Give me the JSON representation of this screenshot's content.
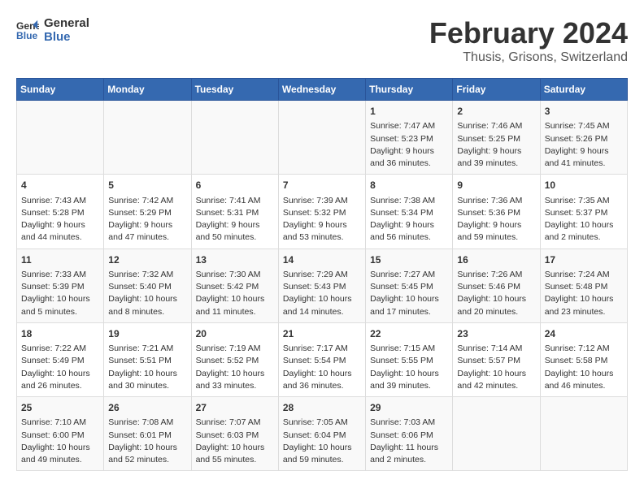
{
  "header": {
    "logo_line1": "General",
    "logo_line2": "Blue",
    "month_year": "February 2024",
    "location": "Thusis, Grisons, Switzerland"
  },
  "days_of_week": [
    "Sunday",
    "Monday",
    "Tuesday",
    "Wednesday",
    "Thursday",
    "Friday",
    "Saturday"
  ],
  "weeks": [
    [
      {
        "day": "",
        "content": ""
      },
      {
        "day": "",
        "content": ""
      },
      {
        "day": "",
        "content": ""
      },
      {
        "day": "",
        "content": ""
      },
      {
        "day": "1",
        "content": "Sunrise: 7:47 AM\nSunset: 5:23 PM\nDaylight: 9 hours and 36 minutes."
      },
      {
        "day": "2",
        "content": "Sunrise: 7:46 AM\nSunset: 5:25 PM\nDaylight: 9 hours and 39 minutes."
      },
      {
        "day": "3",
        "content": "Sunrise: 7:45 AM\nSunset: 5:26 PM\nDaylight: 9 hours and 41 minutes."
      }
    ],
    [
      {
        "day": "4",
        "content": "Sunrise: 7:43 AM\nSunset: 5:28 PM\nDaylight: 9 hours and 44 minutes."
      },
      {
        "day": "5",
        "content": "Sunrise: 7:42 AM\nSunset: 5:29 PM\nDaylight: 9 hours and 47 minutes."
      },
      {
        "day": "6",
        "content": "Sunrise: 7:41 AM\nSunset: 5:31 PM\nDaylight: 9 hours and 50 minutes."
      },
      {
        "day": "7",
        "content": "Sunrise: 7:39 AM\nSunset: 5:32 PM\nDaylight: 9 hours and 53 minutes."
      },
      {
        "day": "8",
        "content": "Sunrise: 7:38 AM\nSunset: 5:34 PM\nDaylight: 9 hours and 56 minutes."
      },
      {
        "day": "9",
        "content": "Sunrise: 7:36 AM\nSunset: 5:36 PM\nDaylight: 9 hours and 59 minutes."
      },
      {
        "day": "10",
        "content": "Sunrise: 7:35 AM\nSunset: 5:37 PM\nDaylight: 10 hours and 2 minutes."
      }
    ],
    [
      {
        "day": "11",
        "content": "Sunrise: 7:33 AM\nSunset: 5:39 PM\nDaylight: 10 hours and 5 minutes."
      },
      {
        "day": "12",
        "content": "Sunrise: 7:32 AM\nSunset: 5:40 PM\nDaylight: 10 hours and 8 minutes."
      },
      {
        "day": "13",
        "content": "Sunrise: 7:30 AM\nSunset: 5:42 PM\nDaylight: 10 hours and 11 minutes."
      },
      {
        "day": "14",
        "content": "Sunrise: 7:29 AM\nSunset: 5:43 PM\nDaylight: 10 hours and 14 minutes."
      },
      {
        "day": "15",
        "content": "Sunrise: 7:27 AM\nSunset: 5:45 PM\nDaylight: 10 hours and 17 minutes."
      },
      {
        "day": "16",
        "content": "Sunrise: 7:26 AM\nSunset: 5:46 PM\nDaylight: 10 hours and 20 minutes."
      },
      {
        "day": "17",
        "content": "Sunrise: 7:24 AM\nSunset: 5:48 PM\nDaylight: 10 hours and 23 minutes."
      }
    ],
    [
      {
        "day": "18",
        "content": "Sunrise: 7:22 AM\nSunset: 5:49 PM\nDaylight: 10 hours and 26 minutes."
      },
      {
        "day": "19",
        "content": "Sunrise: 7:21 AM\nSunset: 5:51 PM\nDaylight: 10 hours and 30 minutes."
      },
      {
        "day": "20",
        "content": "Sunrise: 7:19 AM\nSunset: 5:52 PM\nDaylight: 10 hours and 33 minutes."
      },
      {
        "day": "21",
        "content": "Sunrise: 7:17 AM\nSunset: 5:54 PM\nDaylight: 10 hours and 36 minutes."
      },
      {
        "day": "22",
        "content": "Sunrise: 7:15 AM\nSunset: 5:55 PM\nDaylight: 10 hours and 39 minutes."
      },
      {
        "day": "23",
        "content": "Sunrise: 7:14 AM\nSunset: 5:57 PM\nDaylight: 10 hours and 42 minutes."
      },
      {
        "day": "24",
        "content": "Sunrise: 7:12 AM\nSunset: 5:58 PM\nDaylight: 10 hours and 46 minutes."
      }
    ],
    [
      {
        "day": "25",
        "content": "Sunrise: 7:10 AM\nSunset: 6:00 PM\nDaylight: 10 hours and 49 minutes."
      },
      {
        "day": "26",
        "content": "Sunrise: 7:08 AM\nSunset: 6:01 PM\nDaylight: 10 hours and 52 minutes."
      },
      {
        "day": "27",
        "content": "Sunrise: 7:07 AM\nSunset: 6:03 PM\nDaylight: 10 hours and 55 minutes."
      },
      {
        "day": "28",
        "content": "Sunrise: 7:05 AM\nSunset: 6:04 PM\nDaylight: 10 hours and 59 minutes."
      },
      {
        "day": "29",
        "content": "Sunrise: 7:03 AM\nSunset: 6:06 PM\nDaylight: 11 hours and 2 minutes."
      },
      {
        "day": "",
        "content": ""
      },
      {
        "day": "",
        "content": ""
      }
    ]
  ]
}
